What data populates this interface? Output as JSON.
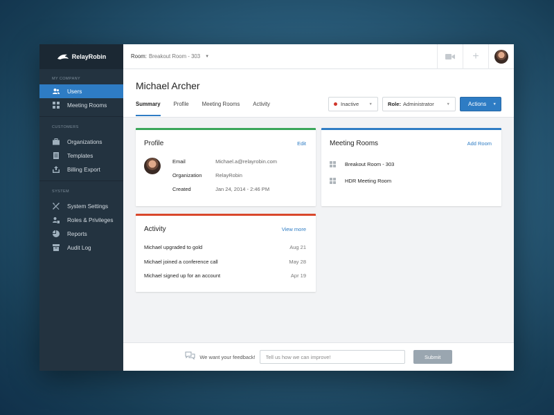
{
  "brand": {
    "name": "RelayRobin"
  },
  "sidebar": {
    "sections": [
      {
        "title": "My Company",
        "items": [
          {
            "label": "Users",
            "icon": "users-icon",
            "active": true
          },
          {
            "label": "Meeting Rooms",
            "icon": "grid-icon",
            "active": false
          }
        ]
      },
      {
        "title": "Customers",
        "items": [
          {
            "label": "Organizations",
            "icon": "briefcase-icon"
          },
          {
            "label": "Templates",
            "icon": "document-icon"
          },
          {
            "label": "Billing Export",
            "icon": "export-icon"
          }
        ]
      },
      {
        "title": "System",
        "items": [
          {
            "label": "System Settings",
            "icon": "tools-icon"
          },
          {
            "label": "Roles & Privileges",
            "icon": "user-lock-icon"
          },
          {
            "label": "Reports",
            "icon": "pie-chart-icon"
          },
          {
            "label": "Audit Log",
            "icon": "archive-icon"
          }
        ]
      }
    ]
  },
  "topbar": {
    "room_label": "Room:",
    "room_value": "Breakout Room - 303",
    "plus_label": "+"
  },
  "header": {
    "name": "Michael Archer",
    "tabs": [
      "Summary",
      "Profile",
      "Meeting Rooms",
      "Activity"
    ],
    "status": "Inactive",
    "role_label": "Role:",
    "role_value": "Administrator",
    "actions_label": "Actions"
  },
  "profile_card": {
    "title": "Profile",
    "edit_label": "Edit",
    "fields": [
      {
        "key": "Email",
        "value": "Michael.a@relayrobin.com"
      },
      {
        "key": "Organization",
        "value": "RelayRobin"
      },
      {
        "key": "Created",
        "value": "Jan 24, 2014 - 2:46 PM"
      }
    ]
  },
  "rooms_card": {
    "title": "Meeting Rooms",
    "add_label": "Add Room",
    "rooms": [
      "Breakout Room - 303",
      "HDR Meeting Room"
    ]
  },
  "activity_card": {
    "title": "Activity",
    "view_more_label": "View more",
    "items": [
      {
        "text": "Michael upgraded to gold",
        "date": "Aug 21"
      },
      {
        "text": "Michael joined a conference call",
        "date": "May 28"
      },
      {
        "text": "Michael signed up for an account",
        "date": "Apr 19"
      }
    ]
  },
  "footer": {
    "feedback_text": "We want your feedback!",
    "input_placeholder": "Tell us how we can improve!",
    "submit_label": "Submit"
  },
  "colors": {
    "accent": "#2e7cc4",
    "sidebar": "#233340",
    "profile_bar": "#3aa65a",
    "rooms_bar": "#2e7cc4",
    "activity_bar": "#d9472b",
    "inactive_dot": "#d0362b"
  }
}
